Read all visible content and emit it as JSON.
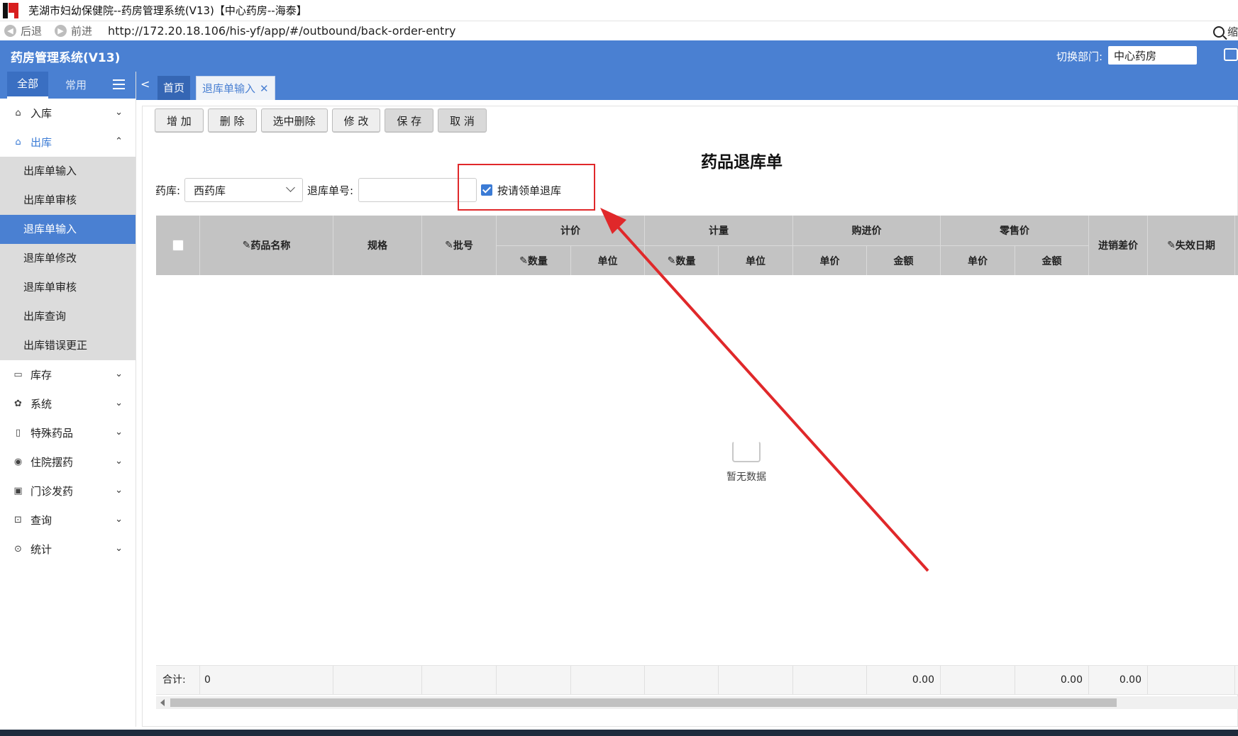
{
  "window": {
    "title": "芜湖市妇幼保健院--药房管理系统(V13)【中心药房--海泰】"
  },
  "browser": {
    "back_label": "后退",
    "forward_label": "前进",
    "url": "http://172.20.18.106/his-yf/app/#/outbound/back-order-entry",
    "zoom_label": "缩"
  },
  "header": {
    "app_title": "药房管理系统(V13)",
    "dept_label": "切换部门:",
    "dept_value": "中心药房"
  },
  "sidebar": {
    "tabs": [
      "全部",
      "常用"
    ],
    "menu": [
      {
        "label": "入库",
        "icon": "inbound-icon",
        "expanded": false
      },
      {
        "label": "出库",
        "icon": "outbound-icon",
        "expanded": true,
        "children": [
          "出库单输入",
          "出库单审核",
          "退库单输入",
          "退库单修改",
          "退库单审核",
          "出库查询",
          "出库错误更正"
        ]
      },
      {
        "label": "库存",
        "icon": "stock-icon",
        "expanded": false
      },
      {
        "label": "系统",
        "icon": "gear-icon",
        "expanded": false
      },
      {
        "label": "特殊药品",
        "icon": "special-drug-icon",
        "expanded": false
      },
      {
        "label": "住院摆药",
        "icon": "inpatient-icon",
        "expanded": false
      },
      {
        "label": "门诊发药",
        "icon": "outpatient-icon",
        "expanded": false
      },
      {
        "label": "查询",
        "icon": "query-icon",
        "expanded": false
      },
      {
        "label": "统计",
        "icon": "stats-icon",
        "expanded": false
      }
    ]
  },
  "tabs": {
    "home": "首页",
    "current": "退库单输入",
    "close_glyph": "✕"
  },
  "toolbar": {
    "add": "增 加",
    "delete": "删 除",
    "delete_selected": "选中删除",
    "edit": "修 改",
    "save": "保 存",
    "cancel": "取 消"
  },
  "form": {
    "title": "药品退库单",
    "pharmacy_label": "药库:",
    "pharmacy_value": "西药库",
    "order_no_label": "退库单号:",
    "order_no_value": "",
    "by_requisition_label": "按请领单退库",
    "by_requisition_checked": true
  },
  "table": {
    "columns": {
      "name": "药品名称",
      "spec": "规格",
      "batch": "批号",
      "pricing": "计价",
      "pricing_qty": "数量",
      "pricing_unit": "单位",
      "measure": "计量",
      "measure_qty": "数量",
      "measure_unit": "单位",
      "purchase": "购进价",
      "purchase_price": "单价",
      "purchase_amount": "金额",
      "retail": "零售价",
      "retail_price": "单价",
      "retail_amount": "金额",
      "diff": "进销差价",
      "expiry": "失效日期"
    },
    "empty_text": "暂无数据",
    "footer": {
      "label": "合计:",
      "count": "0",
      "purchase_amount": "0.00",
      "retail_amount": "0.00",
      "diff": "0.00"
    }
  },
  "colors": {
    "brand": "#4a80d2",
    "annotation": "#e0282a"
  }
}
